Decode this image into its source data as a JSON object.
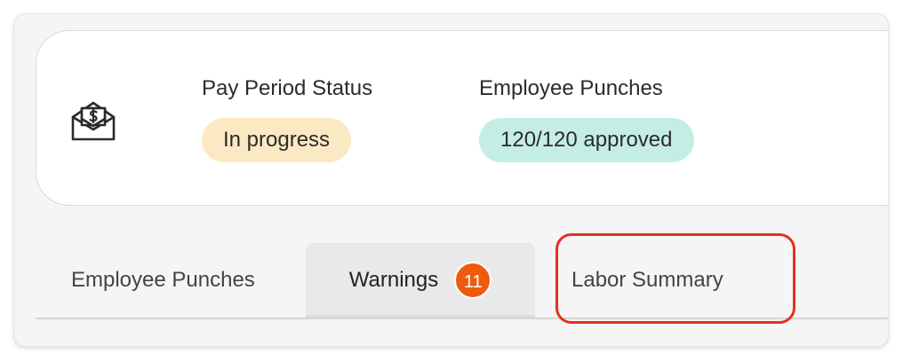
{
  "status_card": {
    "icon": "envelope-dollar-icon",
    "pay_period": {
      "label": "Pay Period Status",
      "value": "In progress",
      "color": "#fbe9c3"
    },
    "employee_punches": {
      "label": "Employee Punches",
      "value": "120/120 approved",
      "color": "#c4ede5"
    }
  },
  "tabs": {
    "items": [
      {
        "label": "Employee Punches"
      },
      {
        "label": "Warnings",
        "badge": "11",
        "active": true
      },
      {
        "label": "Labor Summary",
        "highlighted": true
      }
    ],
    "badge_color": "#ee5b0f",
    "highlight_color": "#e5301e"
  }
}
